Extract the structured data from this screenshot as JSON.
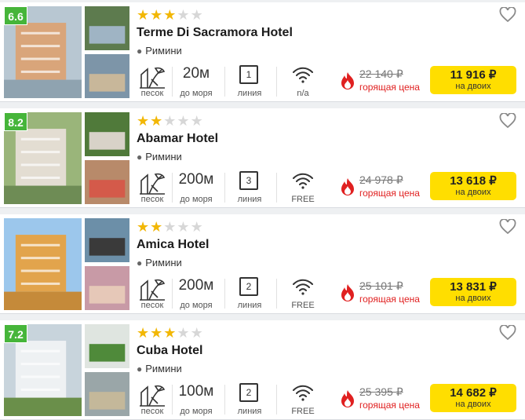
{
  "colors": {
    "rating": "#46b53a",
    "star_on": "#f2b705",
    "price_button": "#ffde00",
    "hot": "#e02020"
  },
  "labels": {
    "beach": "песок",
    "distance_unit": "до моря",
    "line_unit": "линия",
    "hot_price": "горящая цена",
    "for_two": "на двоих"
  },
  "hotels": [
    {
      "rating": "6.6",
      "stars": 3,
      "name": "Terme Di Sacramora Hotel",
      "city": "Римини",
      "distance": "20м",
      "line": "1",
      "wifi": "n/a",
      "old_price": "22 140 ₽",
      "price": "11 916 ₽"
    },
    {
      "rating": "8.2",
      "stars": 2,
      "name": "Abamar Hotel",
      "city": "Римини",
      "distance": "200м",
      "line": "3",
      "wifi": "FREE",
      "old_price": "24 978 ₽",
      "price": "13 618 ₽"
    },
    {
      "rating": "",
      "stars": 2,
      "name": "Amica Hotel",
      "city": "Римини",
      "distance": "200м",
      "line": "2",
      "wifi": "FREE",
      "old_price": "25 101 ₽",
      "price": "13 831 ₽"
    },
    {
      "rating": "7.2",
      "stars": 3,
      "name": "Cuba Hotel",
      "city": "Римини",
      "distance": "100м",
      "line": "2",
      "wifi": "FREE",
      "old_price": "25 395 ₽",
      "price": "14 682 ₽"
    }
  ]
}
